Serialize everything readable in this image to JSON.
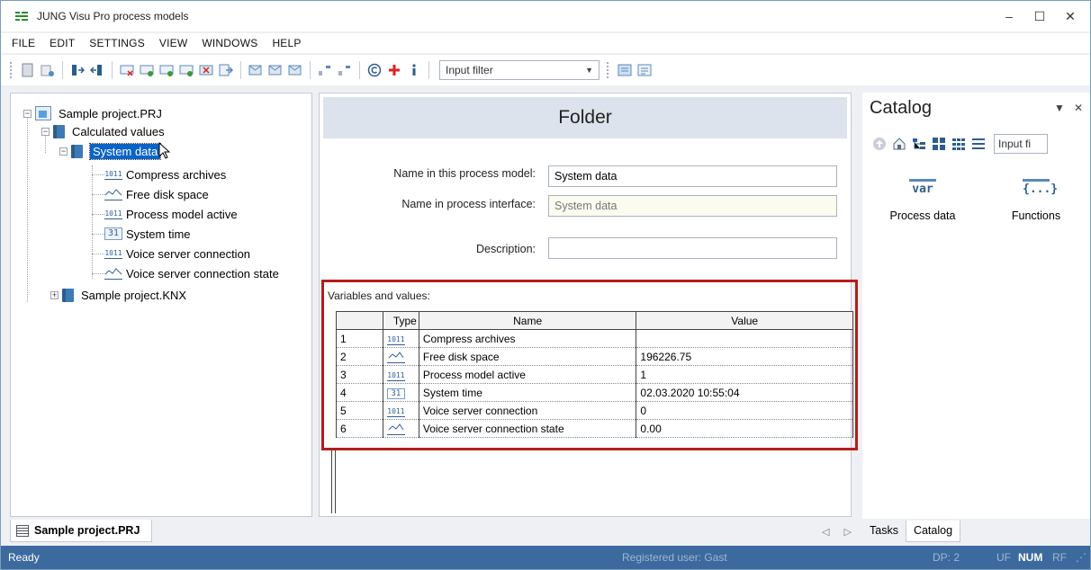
{
  "window": {
    "title": "JUNG Visu Pro process models",
    "controls": {
      "minimize": "–",
      "maximize": "☐",
      "close": "✕"
    }
  },
  "menu": [
    "FILE",
    "EDIT",
    "SETTINGS",
    "VIEW",
    "WINDOWS",
    "HELP"
  ],
  "toolbar": {
    "input_filter_placeholder": "Input filter"
  },
  "tree": {
    "root": "Sample project.PRJ",
    "calculated": "Calculated values",
    "selected": "System data",
    "items": [
      {
        "label": "Compress archives",
        "icon": "binary-icon"
      },
      {
        "label": "Free disk space",
        "icon": "analog-icon"
      },
      {
        "label": "Process model active",
        "icon": "binary-icon"
      },
      {
        "label": "System time",
        "icon": "clock-icon"
      },
      {
        "label": "Voice server connection",
        "icon": "binary-icon"
      },
      {
        "label": "Voice server connection state",
        "icon": "analog-icon"
      }
    ],
    "knx": "Sample project.KNX"
  },
  "folder": {
    "title": "Folder",
    "name_label": "Name in this process model:",
    "name_value": "System data",
    "iface_label": "Name in process interface:",
    "iface_value": "System data",
    "desc_label": "Description:",
    "desc_value": ""
  },
  "variables": {
    "label": "Variables and values:",
    "columns": {
      "type": "Type",
      "name": "Name",
      "value": "Value"
    },
    "rows": [
      {
        "n": "1",
        "name": "Compress archives",
        "value": ""
      },
      {
        "n": "2",
        "name": "Free disk space",
        "value": "196226.75"
      },
      {
        "n": "3",
        "name": "Process model active",
        "value": "1"
      },
      {
        "n": "4",
        "name": "System time",
        "value": "02.03.2020 10:55:04"
      },
      {
        "n": "5",
        "name": "Voice server connection",
        "value": "0"
      },
      {
        "n": "6",
        "name": "Voice server connection state",
        "value": "0.00"
      }
    ]
  },
  "catalog": {
    "title": "Catalog",
    "filter": "Input fi",
    "items": [
      {
        "label": "Process data",
        "glyph": "var"
      },
      {
        "label": "Functions",
        "glyph": "{...}"
      }
    ],
    "tabs": [
      "Tasks",
      "Catalog"
    ]
  },
  "doc_tab": "Sample project.PRJ",
  "status": {
    "left": "Ready",
    "user": "Registered user: Gast",
    "dp": "DP: 2",
    "uf": "UF",
    "num": "NUM",
    "rf": "RF"
  },
  "colors": {
    "accent": "#3c6a9e",
    "highlight_border": "#b51c1c",
    "selection": "#0a64c8"
  }
}
